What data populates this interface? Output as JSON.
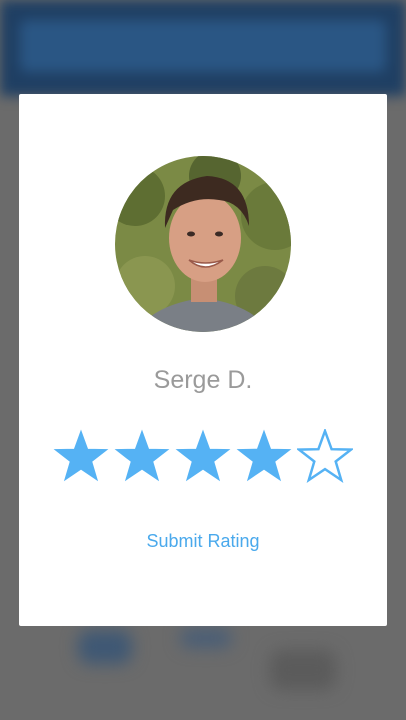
{
  "user": {
    "name": "Serge D."
  },
  "rating": {
    "value": 4,
    "max": 5,
    "star_color": "#55b2f4"
  },
  "actions": {
    "submit_label": "Submit Rating"
  },
  "colors": {
    "accent": "#4aa9ec",
    "name_text": "#9a9a9a",
    "overlay": "#6b6b6b"
  }
}
